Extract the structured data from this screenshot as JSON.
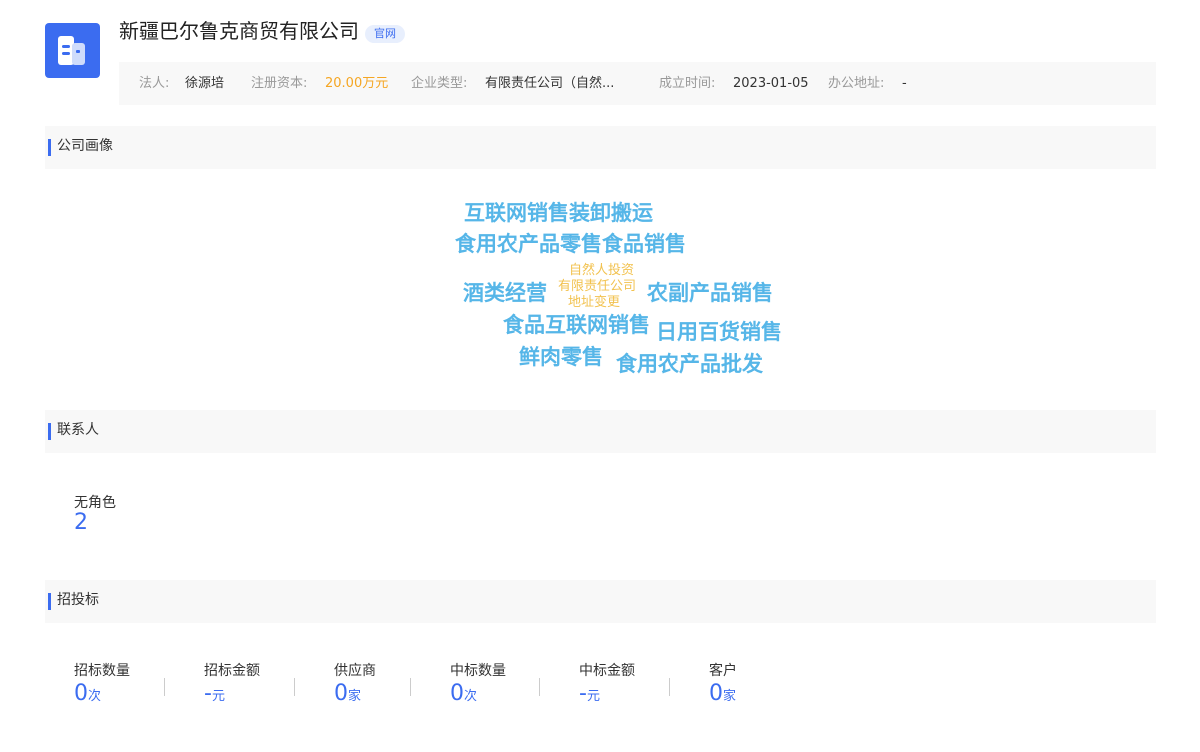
{
  "company": {
    "name": "新疆巴尔鲁克商贸有限公司",
    "badge": "官网",
    "logo_color": "#3b6cf0"
  },
  "info": {
    "legal_rep_label": "法人:",
    "legal_rep": "徐源培",
    "capital_label": "注册资本:",
    "capital": "20.00万元",
    "type_label": "企业类型:",
    "type": "有限责任公司（自然...",
    "founded_label": "成立时间:",
    "founded": "2023-01-05",
    "address_label": "办公地址:",
    "address": "-"
  },
  "portrait": {
    "title": "公司画像",
    "tags": [
      "互联网销售装卸搬运",
      "食用农产品零售食品销售",
      "酒类经营",
      "自然人投资",
      "有限责任公司",
      "地址变更",
      "农副产品销售",
      "食品互联网销售",
      "日用百货销售",
      "鲜肉零售",
      "食用农产品批发"
    ],
    "colors": {
      "primary": "#56b6e8",
      "secondary": "#f2c24f"
    }
  },
  "contacts": {
    "title": "联系人",
    "role_label": "无角色",
    "role_count": "2"
  },
  "bidding": {
    "title": "招投标",
    "stats": [
      {
        "label": "招标数量",
        "value": "0",
        "unit": "次"
      },
      {
        "label": "招标金额",
        "value": "-",
        "unit": "元"
      },
      {
        "label": "供应商",
        "value": "0",
        "unit": "家"
      },
      {
        "label": "中标数量",
        "value": "0",
        "unit": "次"
      },
      {
        "label": "中标金额",
        "value": "-",
        "unit": "元"
      },
      {
        "label": "客户",
        "value": "0",
        "unit": "家"
      }
    ]
  }
}
